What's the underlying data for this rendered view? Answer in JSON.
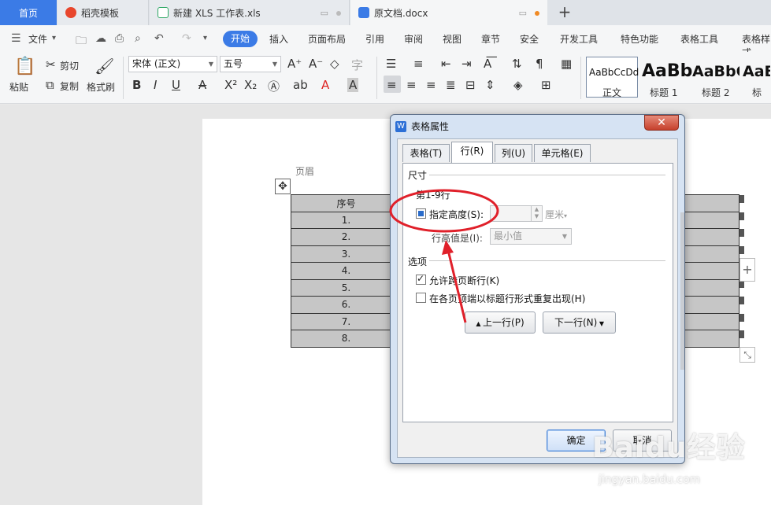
{
  "tabs": [
    {
      "label": "首页"
    },
    {
      "label": "稻壳模板"
    },
    {
      "label": "新建 XLS 工作表.xls"
    },
    {
      "label": "原文档.docx"
    }
  ],
  "tab_plus": "+",
  "menu": {
    "file": "文件",
    "start": "开始",
    "insert": "插入",
    "layout": "页面布局",
    "reference": "引用",
    "review": "审阅",
    "view": "视图",
    "chapter": "章节",
    "security": "安全",
    "devtools": "开发工具",
    "features": "特色功能",
    "table_tools": "表格工具",
    "table_style": "表格样式"
  },
  "ribbon": {
    "paste": "粘贴",
    "cut": "剪切",
    "copy": "复制",
    "format_painter": "格式刷",
    "font_name": "宋体 (正文)",
    "font_size": "五号",
    "styles": [
      {
        "sample": "AaBbCcDd",
        "label": "正文"
      },
      {
        "sample": "AaBb",
        "label": "标题 1"
      },
      {
        "sample": "AaBbC",
        "label": "标题 2"
      },
      {
        "sample": "AaBl",
        "label": "标题"
      }
    ]
  },
  "document": {
    "header_label": "页眉",
    "table_header": "序号",
    "rows": [
      "1.",
      "2.",
      "3.",
      "4.",
      "5.",
      "6.",
      "7.",
      "8."
    ]
  },
  "dialog": {
    "title": "表格属性",
    "close": "✕",
    "tabs": [
      "表格(T)",
      "行(R)",
      "列(U)",
      "单元格(E)"
    ],
    "size_section": "尺寸",
    "row_range": "第1-9行",
    "specify_height": "指定高度(S):",
    "height_value": "",
    "unit": "厘米",
    "row_height_is": "行高值是(I):",
    "row_height_mode": "最小值",
    "options_section": "选项",
    "allow_break": "允许跨页断行(K)",
    "repeat_header": "在各页顶端以标题行形式重复出现(H)",
    "prev_row": "上一行(P)",
    "next_row": "下一行(N)",
    "ok": "确定",
    "cancel": "取消"
  },
  "watermark": {
    "main": "Baidu经验",
    "sub": "jingyan.baidu.com"
  },
  "colors": {
    "accent": "#3b7be6",
    "annotation": "#e0202a"
  }
}
